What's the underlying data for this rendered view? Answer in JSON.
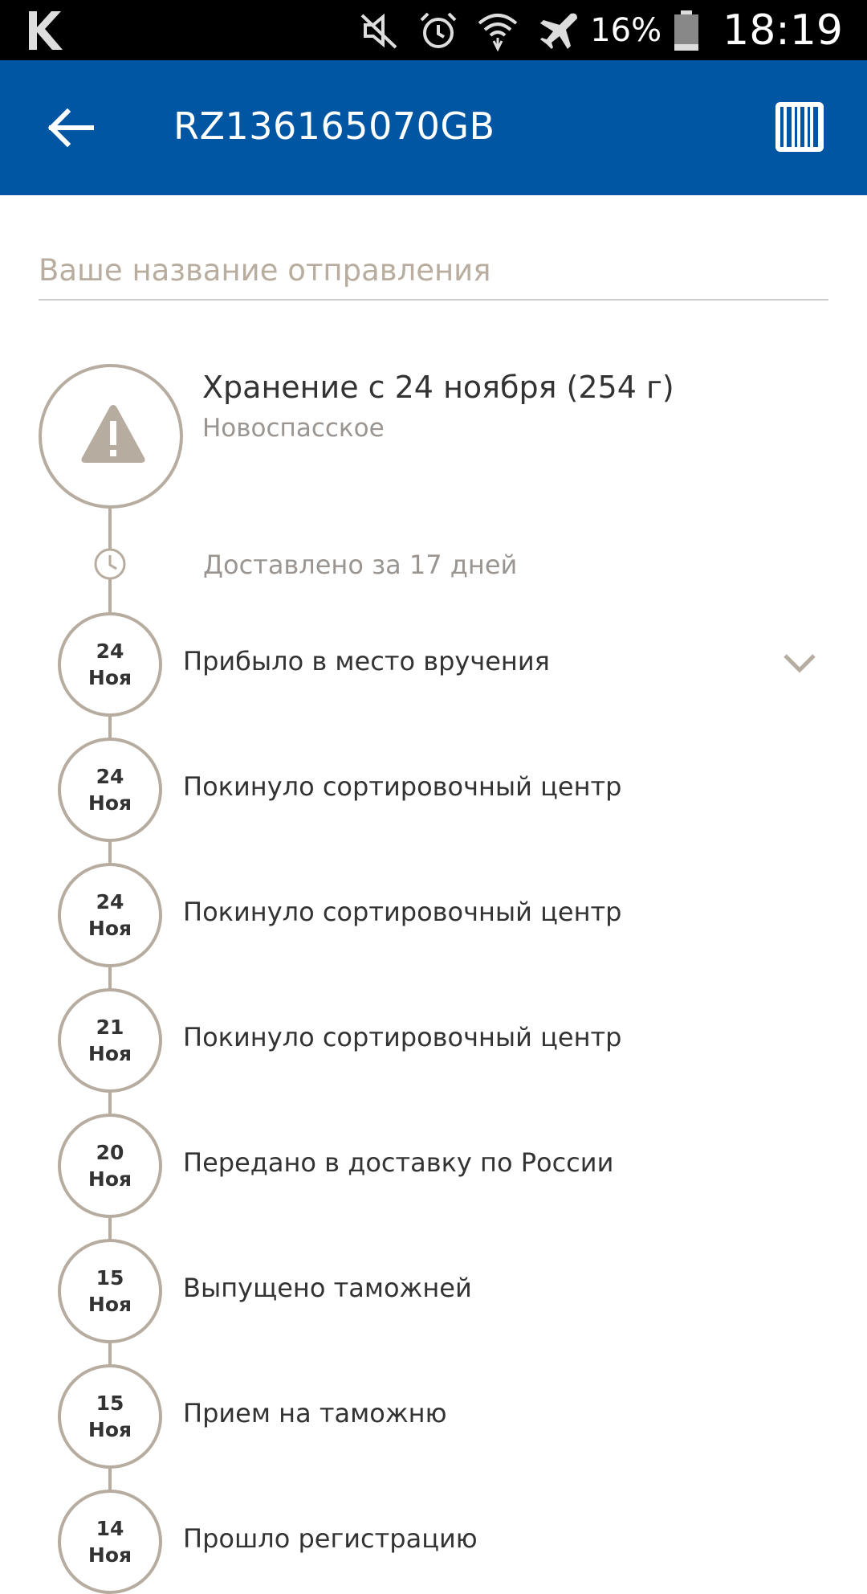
{
  "status_bar": {
    "battery": "16%",
    "time": "18:19"
  },
  "app_bar": {
    "title": "RZ136165070GB"
  },
  "shipment_name": {
    "placeholder": "Ваше название отправления"
  },
  "current_status": {
    "title": "Хранение с 24 ноября (254 г)",
    "location": "Новоспасское"
  },
  "delivered_note": "Доставлено за 17 дней",
  "events": [
    {
      "day": "24",
      "month": "Ноя",
      "label": "Прибыло в место вручения"
    },
    {
      "day": "24",
      "month": "Ноя",
      "label": "Покинуло сортировочный центр"
    },
    {
      "day": "24",
      "month": "Ноя",
      "label": "Покинуло сортировочный центр"
    },
    {
      "day": "21",
      "month": "Ноя",
      "label": "Покинуло сортировочный центр"
    },
    {
      "day": "20",
      "month": "Ноя",
      "label": "Передано в доставку по России"
    },
    {
      "day": "15",
      "month": "Ноя",
      "label": "Выпущено таможней"
    },
    {
      "day": "15",
      "month": "Ноя",
      "label": "Прием на таможню"
    },
    {
      "day": "14",
      "month": "Ноя",
      "label": "Прошло регистрацию"
    }
  ],
  "colors": {
    "app_bar": "#0056a3",
    "timeline": "#b7aca0",
    "text": "#333333",
    "muted": "#9a9590"
  }
}
